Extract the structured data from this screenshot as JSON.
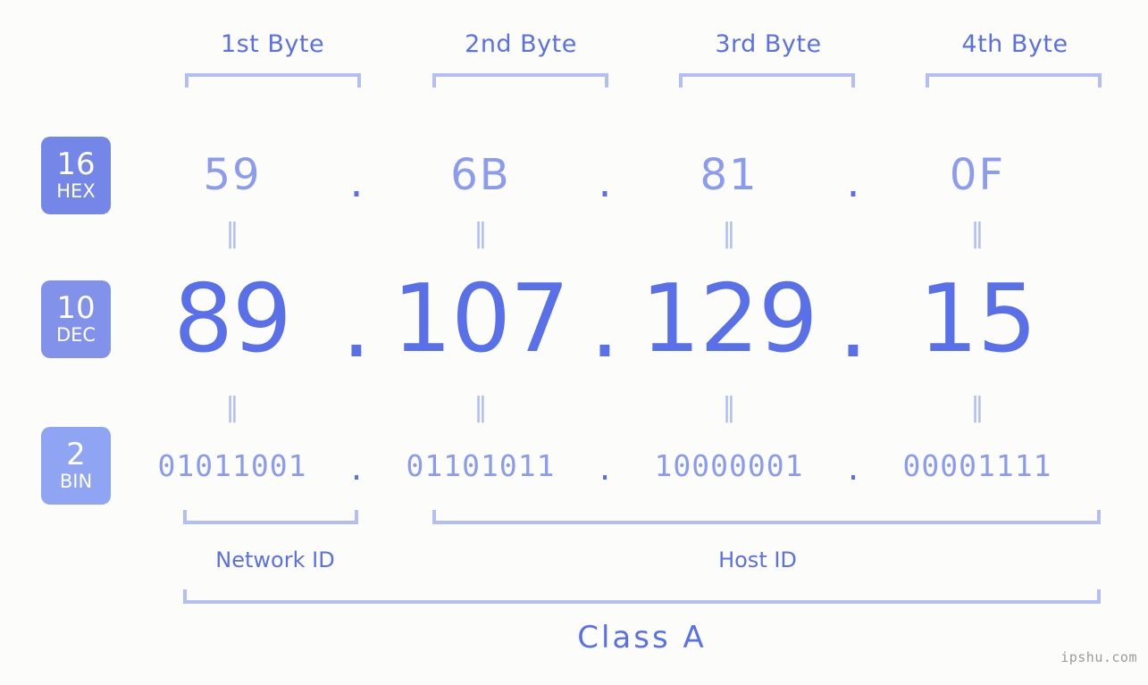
{
  "background_color": "#fcfdfa",
  "accent_color": "#5a70e8",
  "accent_light_color": "#8b9bf0",
  "bracket_color": "#b3bdf6",
  "byte_headers": [
    {
      "label": "1st Byte"
    },
    {
      "label": "2nd Byte"
    },
    {
      "label": "3rd Byte"
    },
    {
      "label": "4th Byte"
    }
  ],
  "bases": [
    {
      "num": "16",
      "word": "HEX",
      "color": "#7486e8"
    },
    {
      "num": "10",
      "word": "DEC",
      "color": "#8292ea"
    },
    {
      "num": "2",
      "word": "BIN",
      "color": "#8fa4f2"
    }
  ],
  "separator": ".",
  "equality_mark": "‖",
  "rows": {
    "hex": {
      "base_label": "HEX",
      "values": [
        "59",
        "6B",
        "81",
        "0F"
      ]
    },
    "dec": {
      "base_label": "DEC",
      "values": [
        "89",
        "107",
        "129",
        "15"
      ]
    },
    "bin": {
      "base_label": "BIN",
      "values": [
        "01011001",
        "01101011",
        "10000001",
        "00001111"
      ]
    }
  },
  "sections": {
    "network_id": "Network ID",
    "host_id": "Host ID",
    "class": "Class A"
  },
  "watermark": "ipshu.com"
}
